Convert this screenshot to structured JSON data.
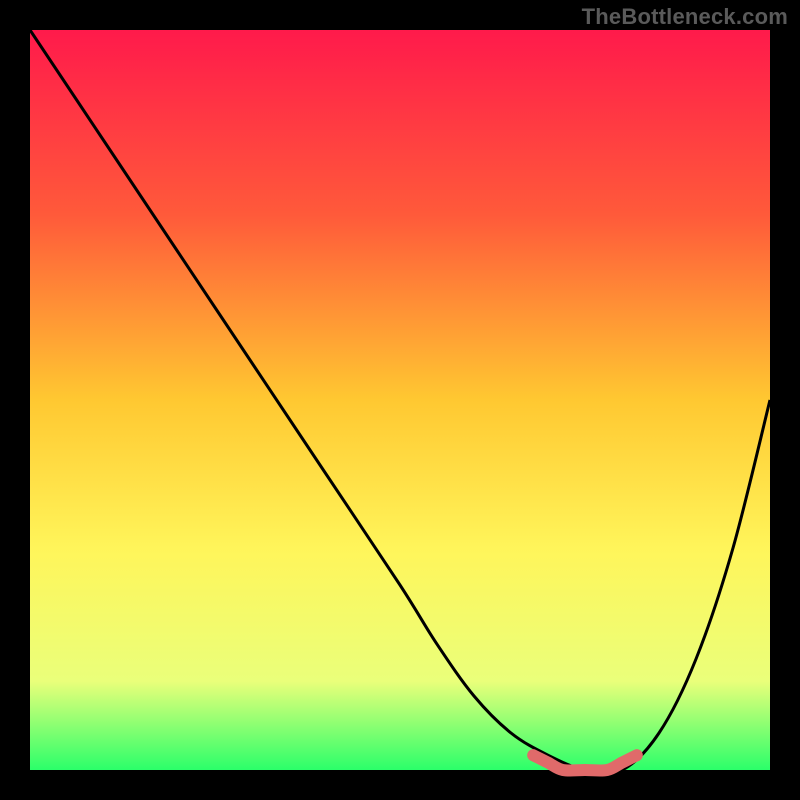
{
  "attribution": "TheBottleneck.com",
  "chart_data": {
    "type": "line",
    "title": "",
    "xlabel": "",
    "ylabel": "",
    "xlim": [
      0,
      100
    ],
    "ylim": [
      0,
      100
    ],
    "series": [
      {
        "name": "bottleneck-curve",
        "x": [
          0,
          10,
          20,
          30,
          40,
          50,
          55,
          60,
          65,
          70,
          75,
          80,
          85,
          90,
          95,
          100
        ],
        "values": [
          100,
          85,
          70,
          55,
          40,
          25,
          17,
          10,
          5,
          2,
          0,
          0,
          5,
          15,
          30,
          50
        ]
      },
      {
        "name": "optimal-range-marker",
        "x": [
          68,
          70,
          72,
          75,
          78,
          80,
          82
        ],
        "values": [
          2,
          1,
          0,
          0,
          0,
          1,
          2
        ]
      }
    ],
    "gradient_stops": [
      {
        "offset": 0,
        "color": "#ff1a4b"
      },
      {
        "offset": 25,
        "color": "#ff5a3a"
      },
      {
        "offset": 50,
        "color": "#ffc831"
      },
      {
        "offset": 70,
        "color": "#fff55a"
      },
      {
        "offset": 88,
        "color": "#eaff7a"
      },
      {
        "offset": 100,
        "color": "#2bff6a"
      }
    ],
    "marker_color": "#e06a6a",
    "curve_color": "#000000"
  }
}
